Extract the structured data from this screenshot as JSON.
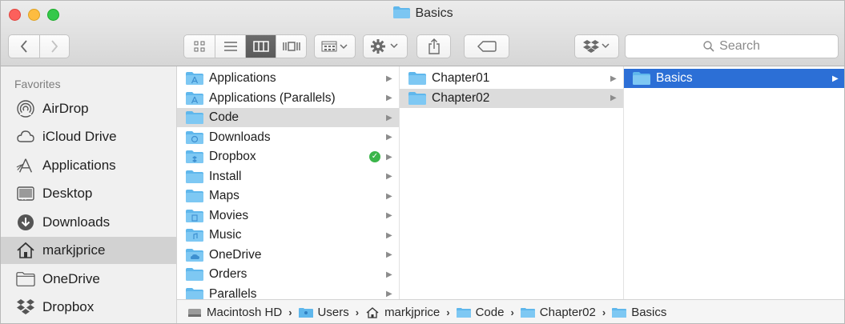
{
  "window": {
    "title": "Basics",
    "folder_color": "#5fb7ec"
  },
  "toolbar": {
    "back_icon": "chevron-left-icon",
    "forward_icon": "chevron-right-icon",
    "view_modes": [
      "icon-view-icon",
      "list-view-icon",
      "column-view-icon",
      "cover-flow-icon"
    ],
    "active_view": "column-view-icon",
    "arrange_icon": "arrange-icon",
    "action_icon": "gear-icon",
    "share_icon": "share-icon",
    "tag_icon": "tag-icon",
    "dropbox_icon": "dropbox-icon",
    "search_placeholder": "Search"
  },
  "sidebar": {
    "heading": "Favorites",
    "items": [
      {
        "label": "AirDrop",
        "icon": "airdrop-icon"
      },
      {
        "label": "iCloud Drive",
        "icon": "cloud-icon"
      },
      {
        "label": "Applications",
        "icon": "applications-icon"
      },
      {
        "label": "Desktop",
        "icon": "desktop-icon"
      },
      {
        "label": "Downloads",
        "icon": "downloads-icon"
      },
      {
        "label": "markjprice",
        "icon": "home-icon",
        "selected": true
      },
      {
        "label": "OneDrive",
        "icon": "folder-icon"
      },
      {
        "label": "Dropbox",
        "icon": "dropbox-icon"
      }
    ]
  },
  "columns": [
    {
      "items": [
        {
          "label": "Applications",
          "has_children": true
        },
        {
          "label": "Applications (Parallels)",
          "has_children": true
        },
        {
          "label": "Code",
          "has_children": true,
          "selected": true
        },
        {
          "label": "Downloads",
          "has_children": true
        },
        {
          "label": "Dropbox",
          "has_children": true,
          "synced": true
        },
        {
          "label": "Install",
          "has_children": true
        },
        {
          "label": "Maps",
          "has_children": true
        },
        {
          "label": "Movies",
          "has_children": true
        },
        {
          "label": "Music",
          "has_children": true
        },
        {
          "label": "OneDrive",
          "has_children": true
        },
        {
          "label": "Orders",
          "has_children": true
        },
        {
          "label": "Parallels",
          "has_children": true
        }
      ]
    },
    {
      "items": [
        {
          "label": "Chapter01",
          "has_children": true
        },
        {
          "label": "Chapter02",
          "has_children": true,
          "selected": true
        }
      ]
    },
    {
      "items": [
        {
          "label": "Basics",
          "has_children": true,
          "selected": true,
          "active": true
        }
      ]
    }
  ],
  "pathbar": {
    "crumbs": [
      {
        "label": "Macintosh HD",
        "icon": "hard-drive-icon"
      },
      {
        "label": "Users",
        "icon": "users-folder-icon"
      },
      {
        "label": "markjprice",
        "icon": "home-icon"
      },
      {
        "label": "Code",
        "icon": "folder-icon"
      },
      {
        "label": "Chapter02",
        "icon": "folder-icon"
      },
      {
        "label": "Basics",
        "icon": "folder-icon"
      }
    ],
    "separator": "›"
  },
  "colors": {
    "selection_blue": "#2c6fd6",
    "selection_gray": "#dcdcdc",
    "folder_blue": "#5fb7ec",
    "synced_green": "#3bb54a"
  }
}
